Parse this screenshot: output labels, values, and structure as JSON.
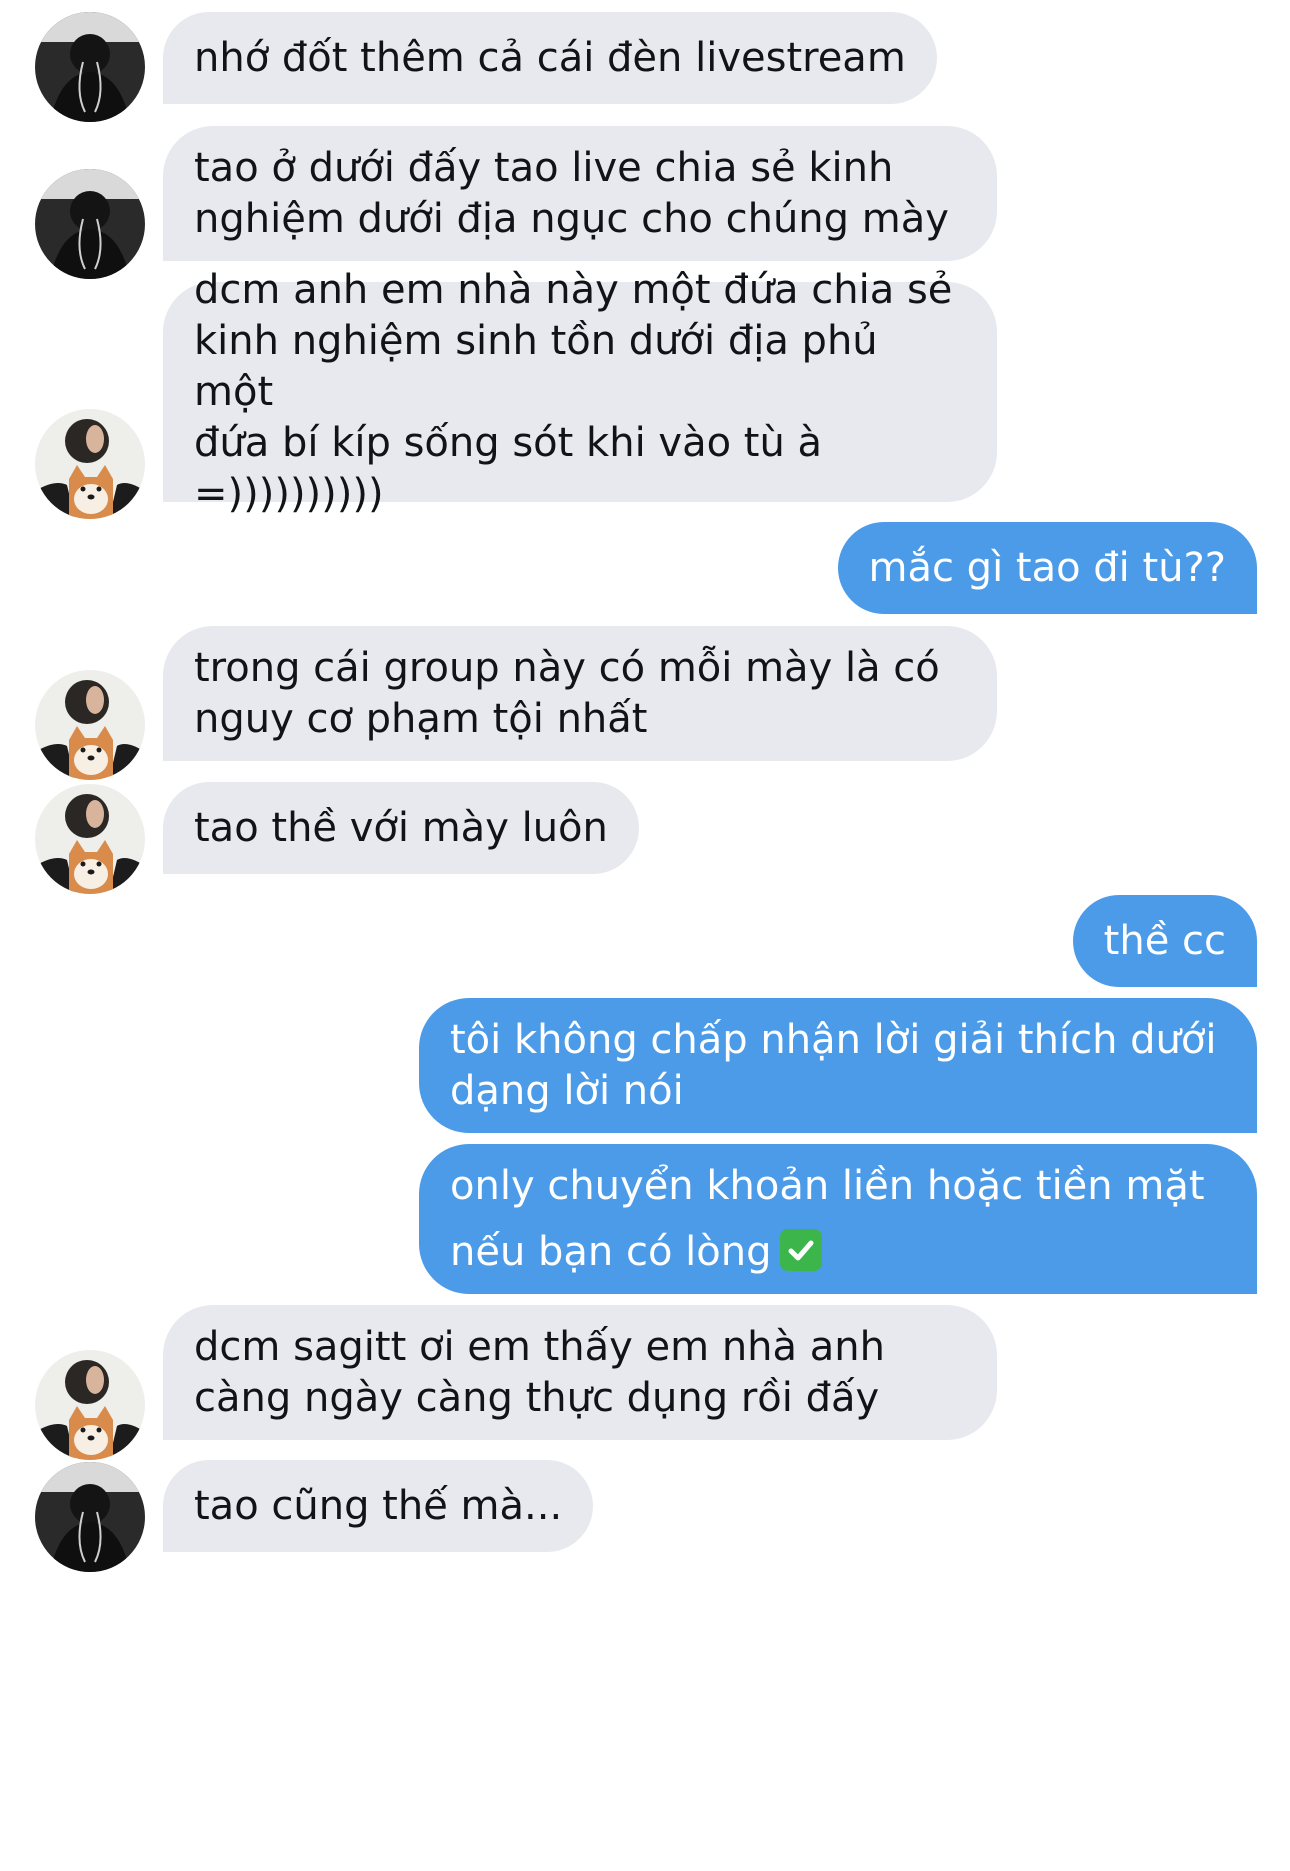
{
  "colors": {
    "incoming_bubble": "#e7e9ee",
    "outgoing_bubble": "#4c9be8",
    "incoming_text": "#111318",
    "outgoing_text": "#ffffff"
  },
  "messages": [
    {
      "direction": "incoming",
      "avatar": "avatar-dark-user",
      "text": "nhớ đốt thêm cả cái đèn livestream"
    },
    {
      "direction": "incoming",
      "avatar": "avatar-dark-user",
      "text": "tao ở dưới đấy tao live chia sẻ kinh\nnghiệm dưới địa ngục cho chúng mày"
    },
    {
      "direction": "incoming",
      "avatar": "avatar-dog-user",
      "text": "dcm anh em nhà này một đứa chia sẻ\nkinh nghiệm sinh tồn dưới địa phủ một\nđứa bí kíp sống sót khi vào tù à\n=))))))))))"
    },
    {
      "direction": "outgoing",
      "text": "mắc gì tao đi tù??"
    },
    {
      "direction": "incoming",
      "avatar": "avatar-dog-user",
      "text": "trong cái group này có mỗi mày là có\nnguy cơ phạm tội nhất"
    },
    {
      "direction": "incoming",
      "avatar": "avatar-dog-user",
      "text": "tao thề với mày luôn"
    },
    {
      "direction": "outgoing",
      "text": "thề cc"
    },
    {
      "direction": "outgoing",
      "text": "tôi không chấp nhận lời giải thích dưới\ndạng lời nói"
    },
    {
      "direction": "outgoing",
      "text": "only chuyển khoản liền hoặc tiền mặt\nnếu bạn có lòng",
      "emoji": "check-mark-button-emoji"
    },
    {
      "direction": "incoming",
      "avatar": "avatar-dog-user",
      "text": "dcm sagitt ơi em thấy em nhà anh\ncàng ngày càng thực dụng rồi đấy"
    },
    {
      "direction": "incoming",
      "avatar": "avatar-dark-user",
      "text": "tao cũng thế mà..."
    }
  ]
}
